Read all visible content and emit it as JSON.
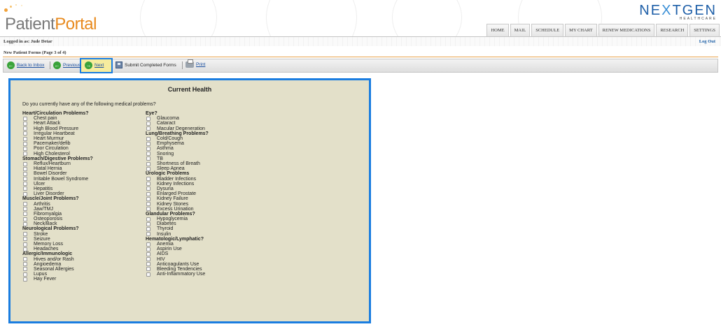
{
  "header": {
    "logo_patient": "Patient",
    "logo_portal": "Portal",
    "brand_next": "NE",
    "brand_x": "X",
    "brand_tgen": "TGEN",
    "brand_sub": "HEALTHCARE",
    "nav": [
      "HOME",
      "MAIL",
      "SCHEDULE",
      "MY CHART",
      "RENEW MEDICATIONS",
      "RESEARCH",
      "SETTINGS"
    ]
  },
  "userbar": {
    "logged_in": "Logged in as: Jude Detar",
    "logout": "Log Out"
  },
  "form_title": "New Patient Forms (Page 3 of 4)",
  "toolbar": {
    "back": "Back to Inbox",
    "previous": "Previous",
    "next": "Next",
    "submit": "Submit Completed Forms",
    "print": "Print"
  },
  "panel": {
    "title": "Current Health",
    "question": "Do you currently have any of the following medical problems?",
    "columns": [
      [
        {
          "group": "Heart/Circulation Problems?",
          "items": [
            "Chest pain",
            "Heart Attack",
            "High Blood Pressure",
            "Irregular Heartbeat",
            "Heart Murmur",
            "Pacemaker/defib",
            "Poor Circulation",
            "High Cholesterol"
          ]
        },
        {
          "group": "Stomach/Digestive Problems?",
          "items": [
            "Reflux/Heartburn",
            "Hiatal Hernia",
            "Bowel Disorder",
            "Irritable Bowel Syndrome",
            "Ulcer",
            "Hepatitis",
            "Liver Disorder"
          ]
        },
        {
          "group": "Muscle/Joint Problems?",
          "items": [
            "Arthritis",
            "Jaw/TMJ",
            "Fibromyalgia",
            "Osteoporosis",
            "Neck/Back"
          ]
        },
        {
          "group": "Neurological Problems?",
          "items": [
            "Stroke",
            "Seizure",
            "Memory Loss",
            "Headaches"
          ]
        },
        {
          "group": "Allergic/Immunologic",
          "items": [
            "Hives and/or Rash",
            "Angioedema",
            "Seasonal Allergies",
            "Lupus",
            "Hay Fever"
          ]
        }
      ],
      [
        {
          "group": "Eye?",
          "items": [
            "Glaucoma",
            "Cataract",
            "Macular Degeneration"
          ]
        },
        {
          "group": "Lung/Breathing Problems?",
          "items": [
            "Cold/Cough",
            "Emphysema",
            "Asthma",
            "Snoring",
            "TB",
            "Shortness of Breath",
            "Sleep Apnea"
          ]
        },
        {
          "group": "Urologic Problems",
          "items": [
            "Bladder Infections",
            "Kidney Infections",
            "Dysuria",
            "Enlarged Prostate",
            "Kidney Failure",
            "Kidney Stones",
            "Excess Urination"
          ]
        },
        {
          "group": "Glandular Problems?",
          "items": [
            "Hypoglycemia",
            "Diabetes",
            "Thyroid",
            "Insulin"
          ]
        },
        {
          "group": "Hematologic/Lymphatic?",
          "items": [
            "Anemia",
            "Aspirin Use",
            "AIDS",
            "HIV",
            "Anticoagulants Use",
            "Bleeding Tendencies",
            "Anti-Inflammatory Use"
          ]
        }
      ]
    ]
  },
  "colors": {
    "accent_blue": "#1a7de0",
    "brand_orange": "#e88a1e",
    "panel_bg": "#e3e0c9",
    "link": "#1a4fa0"
  },
  "icons": [
    "back-arrow-icon",
    "previous-arrow-icon",
    "next-arrow-icon",
    "floppy-disk-icon",
    "printer-icon",
    "checkbox"
  ]
}
